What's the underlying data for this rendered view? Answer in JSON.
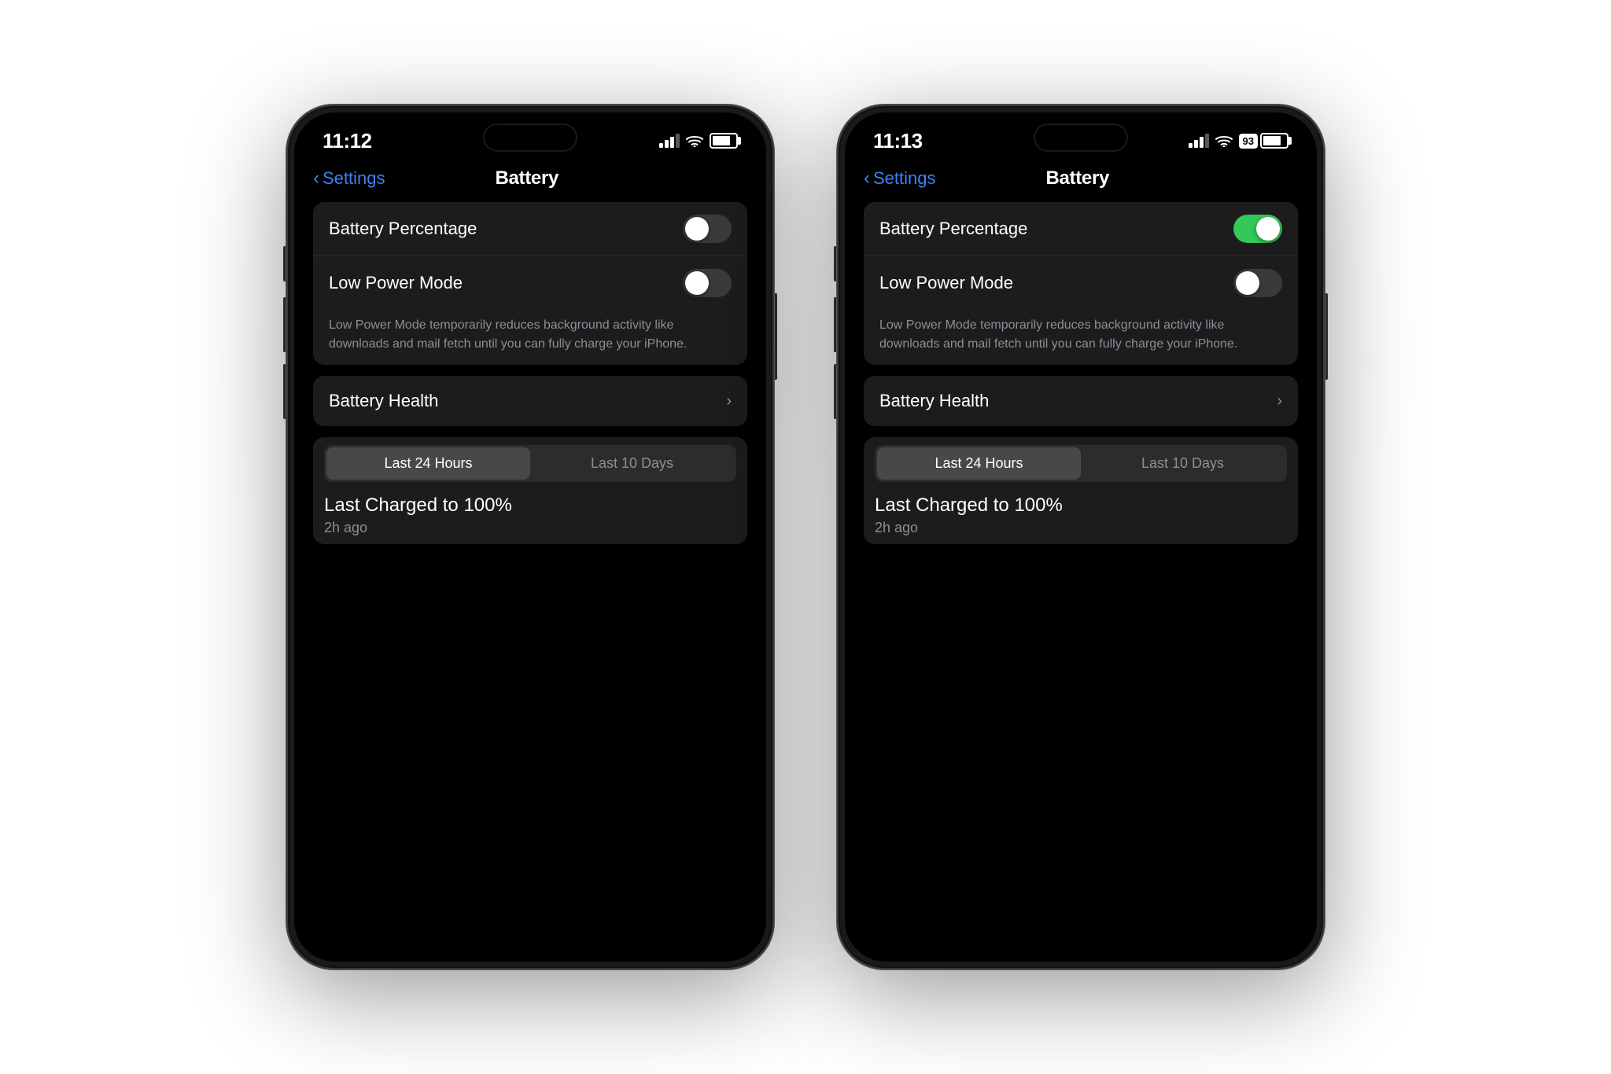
{
  "phones": [
    {
      "id": "phone-left",
      "status": {
        "time": "11:12",
        "battery_percent_shown": false,
        "battery_percent_value": ""
      },
      "nav": {
        "back_label": "Settings",
        "title": "Battery"
      },
      "battery_percentage_toggle": "off",
      "low_power_mode_toggle": "off",
      "battery_percentage_label": "Battery Percentage",
      "low_power_mode_label": "Low Power Mode",
      "low_power_description": "Low Power Mode temporarily reduces background activity like downloads and mail fetch until you can fully charge your iPhone.",
      "battery_health_label": "Battery Health",
      "segment_active": "Last 24 Hours",
      "segment_inactive": "Last 10 Days",
      "last_charged_title": "Last Charged to 100%",
      "last_charged_sub": "2h ago"
    },
    {
      "id": "phone-right",
      "status": {
        "time": "11:13",
        "battery_percent_shown": true,
        "battery_percent_value": "93"
      },
      "nav": {
        "back_label": "Settings",
        "title": "Battery"
      },
      "battery_percentage_toggle": "on",
      "low_power_mode_toggle": "off",
      "battery_percentage_label": "Battery Percentage",
      "low_power_mode_label": "Low Power Mode",
      "low_power_description": "Low Power Mode temporarily reduces background activity like downloads and mail fetch until you can fully charge your iPhone.",
      "battery_health_label": "Battery Health",
      "segment_active": "Last 24 Hours",
      "segment_inactive": "Last 10 Days",
      "last_charged_title": "Last Charged to 100%",
      "last_charged_sub": "2h ago"
    }
  ],
  "colors": {
    "toggle_on": "#34c759",
    "toggle_off": "#3a3a3c",
    "blue": "#3b82f6",
    "text_primary": "#ffffff",
    "text_secondary": "#8e8e93",
    "bg_card": "#1c1c1e",
    "bg_screen": "#000000"
  }
}
